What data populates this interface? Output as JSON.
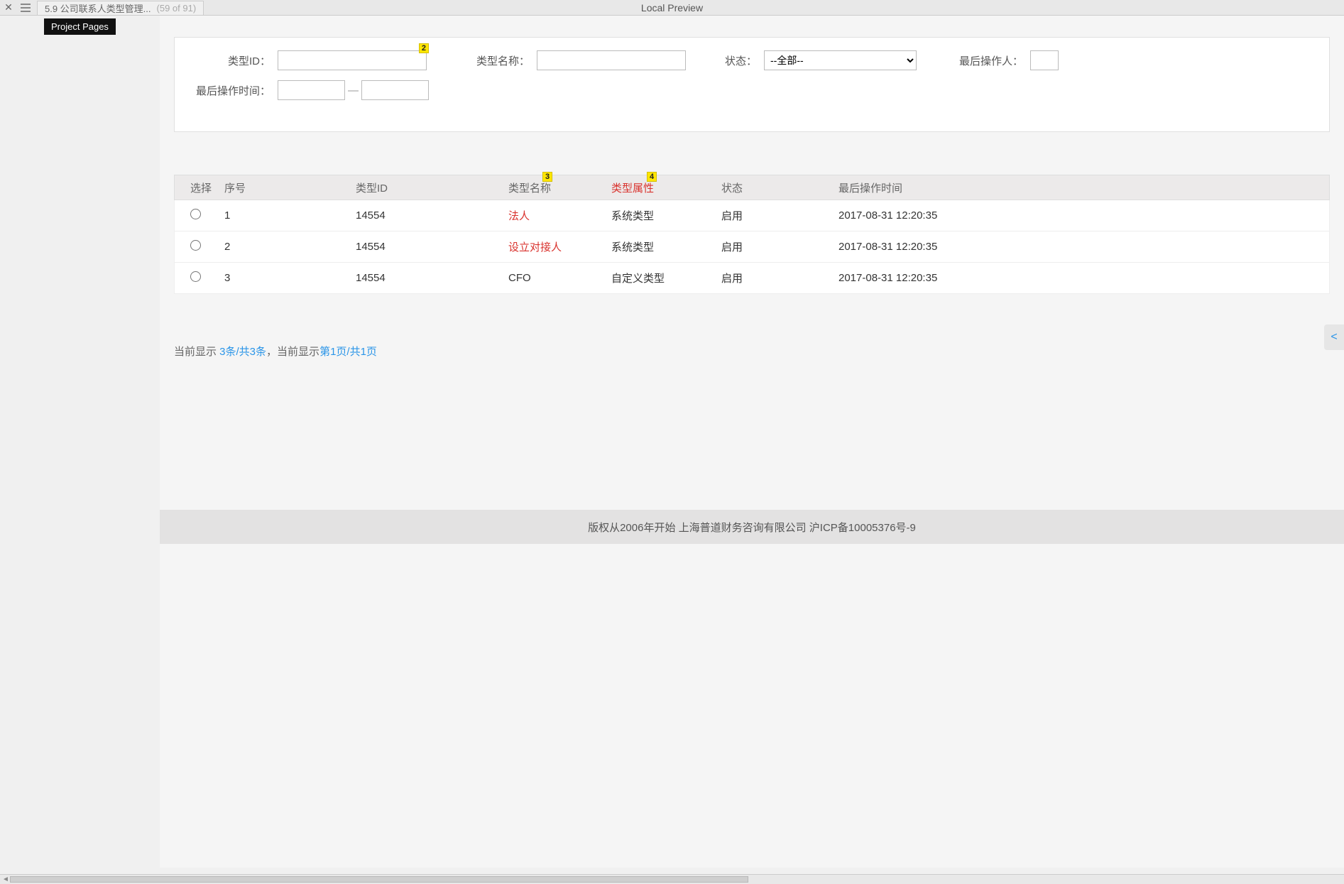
{
  "toolbar": {
    "tab_title": "5.9 公司联系人类型管理...",
    "tab_counter": "(59 of 91)",
    "center_label": "Local Preview",
    "tooltip": "Project Pages"
  },
  "filter": {
    "type_id_label": "类型ID：",
    "type_name_label": "类型名称：",
    "status_label": "状态：",
    "status_selected": "--全部--",
    "last_operator_label": "最后操作人：",
    "last_op_time_label": "最后操作时间：",
    "range_dash": "—"
  },
  "badges": {
    "b2": "2",
    "b3": "3",
    "b4": "4"
  },
  "table": {
    "headers": {
      "select": "选择",
      "seq": "序号",
      "type_id": "类型ID",
      "type_name": "类型名称",
      "type_attr": "类型属性",
      "status": "状态",
      "last_time": "最后操作时间"
    },
    "rows": [
      {
        "seq": "1",
        "type_id": "14554",
        "type_name": "法人",
        "name_red": true,
        "type_attr": "系统类型",
        "status": "启用",
        "time": "2017-08-31 12:20:35"
      },
      {
        "seq": "2",
        "type_id": "14554",
        "type_name": "设立对接人",
        "name_red": true,
        "type_attr": "系统类型",
        "status": "启用",
        "time": "2017-08-31 12:20:35"
      },
      {
        "seq": "3",
        "type_id": "14554",
        "type_name": "CFO",
        "name_red": false,
        "type_attr": "自定义类型",
        "status": "启用",
        "time": "2017-08-31 12:20:35"
      }
    ]
  },
  "pagination": {
    "prefix1": "当前显示 ",
    "count": "3条/共3条",
    "comma": "，",
    "prefix2": "当前显示",
    "page": "第1页/共1页"
  },
  "footer": {
    "text": "版权从2006年开始 上海普道财务咨询有限公司 沪ICP备10005376号-9"
  },
  "chevron": "<"
}
